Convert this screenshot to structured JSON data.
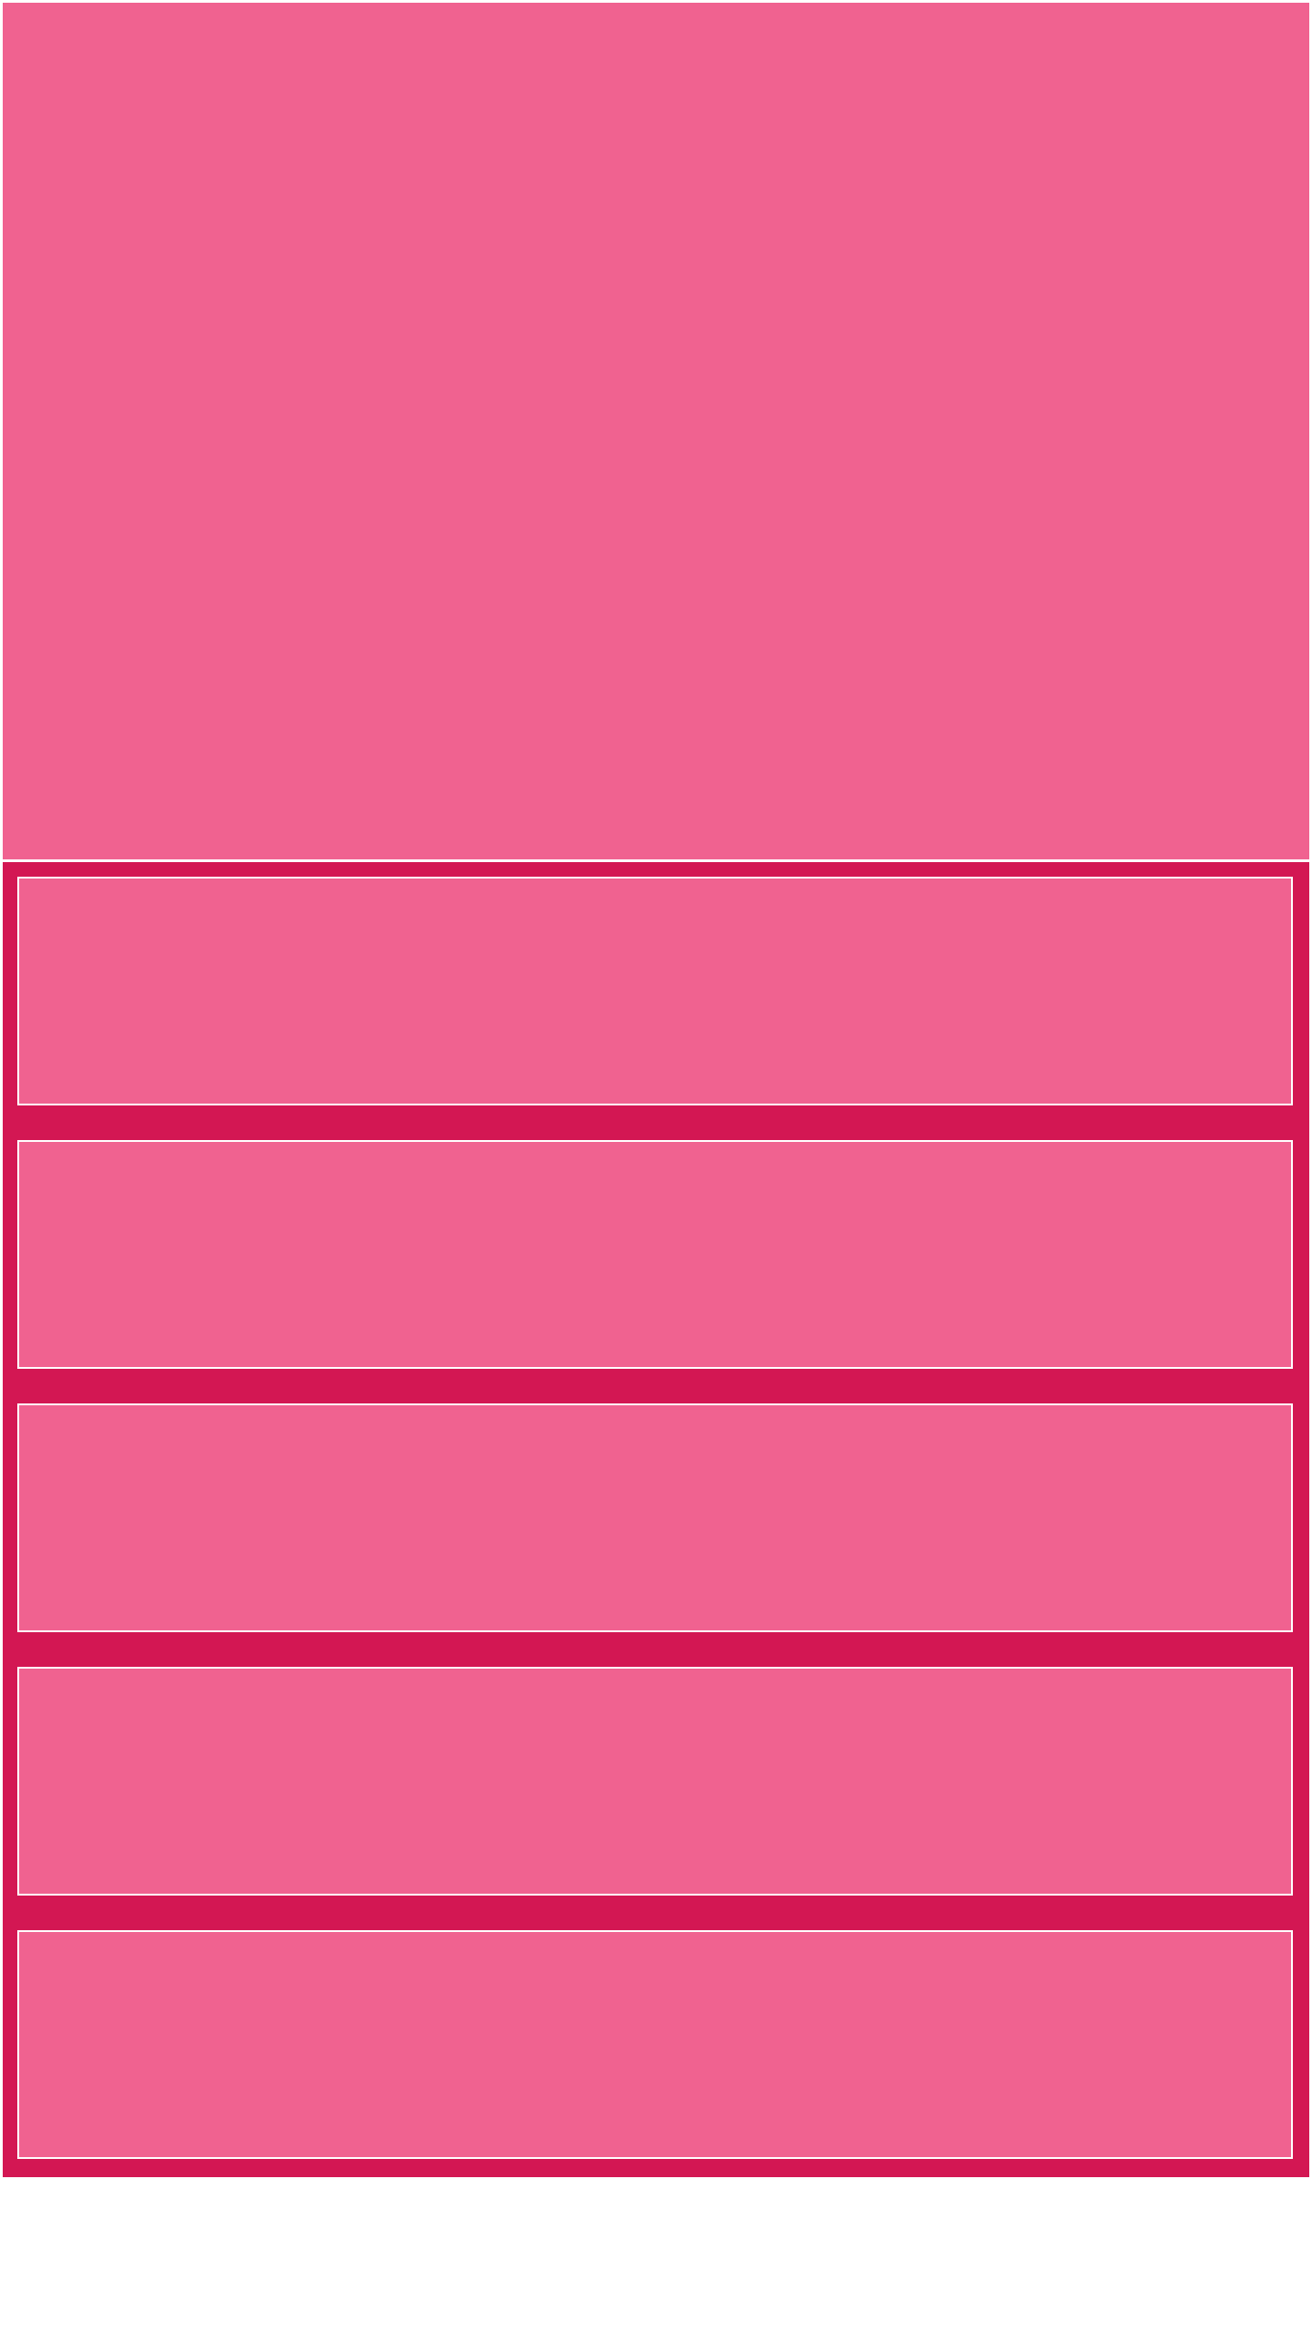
{
  "colors": {
    "background": "#ffffff",
    "hero": "#f06290",
    "panel": "#d31753",
    "card": "#f06290",
    "card_border": "#ffffff"
  },
  "list": {
    "items": [
      {
        "label": ""
      },
      {
        "label": ""
      },
      {
        "label": ""
      },
      {
        "label": ""
      },
      {
        "label": ""
      }
    ]
  }
}
